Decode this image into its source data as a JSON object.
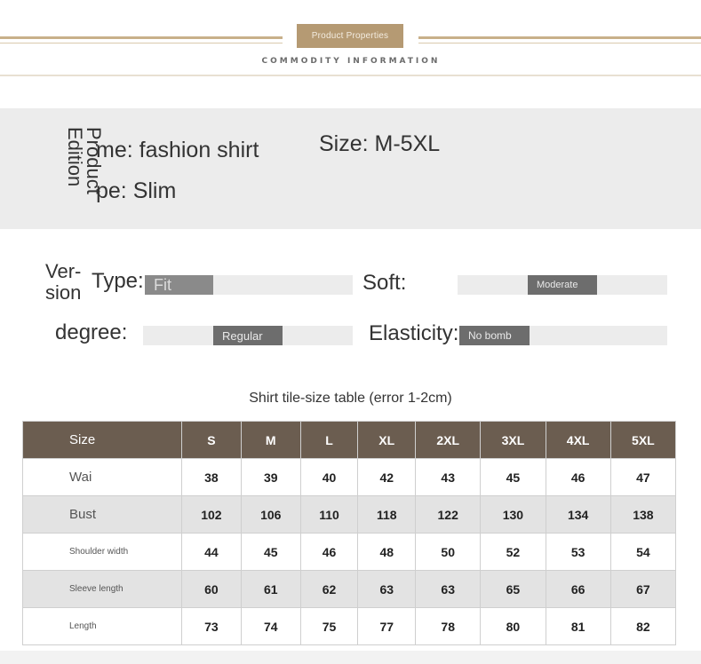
{
  "header": {
    "badge": "Product Properties",
    "subtitle": "COMMODITY INFORMATION"
  },
  "info": {
    "vertical_label": "Product Edition",
    "name": "me: fashion shirt",
    "type": "pe: Slim",
    "size": "Size: M-5XL"
  },
  "attributes": {
    "version_label": "Ver-\nsion",
    "type_label": "Type:",
    "type_value": "Fit",
    "soft_label": "Soft:",
    "soft_value": "Moderate",
    "degree_label": "degree:",
    "degree_value": "Regular",
    "elasticity_label": "Elasticity:",
    "elasticity_value": "No bomb"
  },
  "table": {
    "caption": "Shirt tile-size table (error 1-2cm)",
    "headers": [
      "Size",
      "S",
      "M",
      "L",
      "XL",
      "2XL",
      "3XL",
      "4XL",
      "5XL"
    ],
    "rows": [
      {
        "label": "Wai",
        "values": [
          "38",
          "39",
          "40",
          "42",
          "43",
          "45",
          "46",
          "47"
        ]
      },
      {
        "label": "Bust",
        "values": [
          "102",
          "106",
          "110",
          "118",
          "122",
          "130",
          "134",
          "138"
        ]
      },
      {
        "label": "Shoulder width",
        "values": [
          "44",
          "45",
          "46",
          "48",
          "50",
          "52",
          "53",
          "54"
        ]
      },
      {
        "label": "Sleeve length",
        "values": [
          "60",
          "61",
          "62",
          "63",
          "63",
          "65",
          "66",
          "67"
        ]
      },
      {
        "label": "Length",
        "values": [
          "73",
          "74",
          "75",
          "77",
          "78",
          "80",
          "81",
          "82"
        ]
      }
    ]
  }
}
